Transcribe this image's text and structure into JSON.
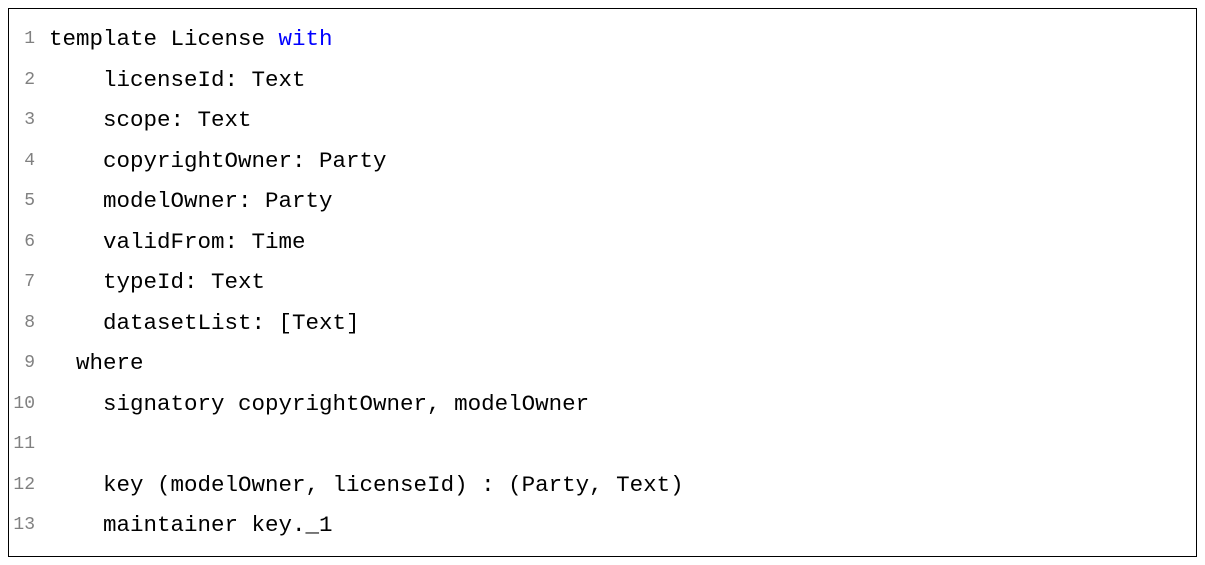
{
  "code": {
    "lineNumbers": [
      "1",
      "2",
      "3",
      "4",
      "5",
      "6",
      "7",
      "8",
      "9",
      "10",
      "11",
      "12",
      "13"
    ],
    "tokens": {
      "line1_pre": "template License ",
      "line1_keyword": "with",
      "line2": "    licenseId: Text",
      "line3": "    scope: Text",
      "line4": "    copyrightOwner: Party",
      "line5": "    modelOwner: Party",
      "line6": "    validFrom: Time",
      "line7": "    typeId: Text",
      "line8": "    datasetList: [Text]",
      "line9": "  where",
      "line10": "    signatory copyrightOwner, modelOwner",
      "line11": "",
      "line12": "    key (modelOwner, licenseId) : (Party, Text)",
      "line13": "    maintainer key._1"
    }
  }
}
